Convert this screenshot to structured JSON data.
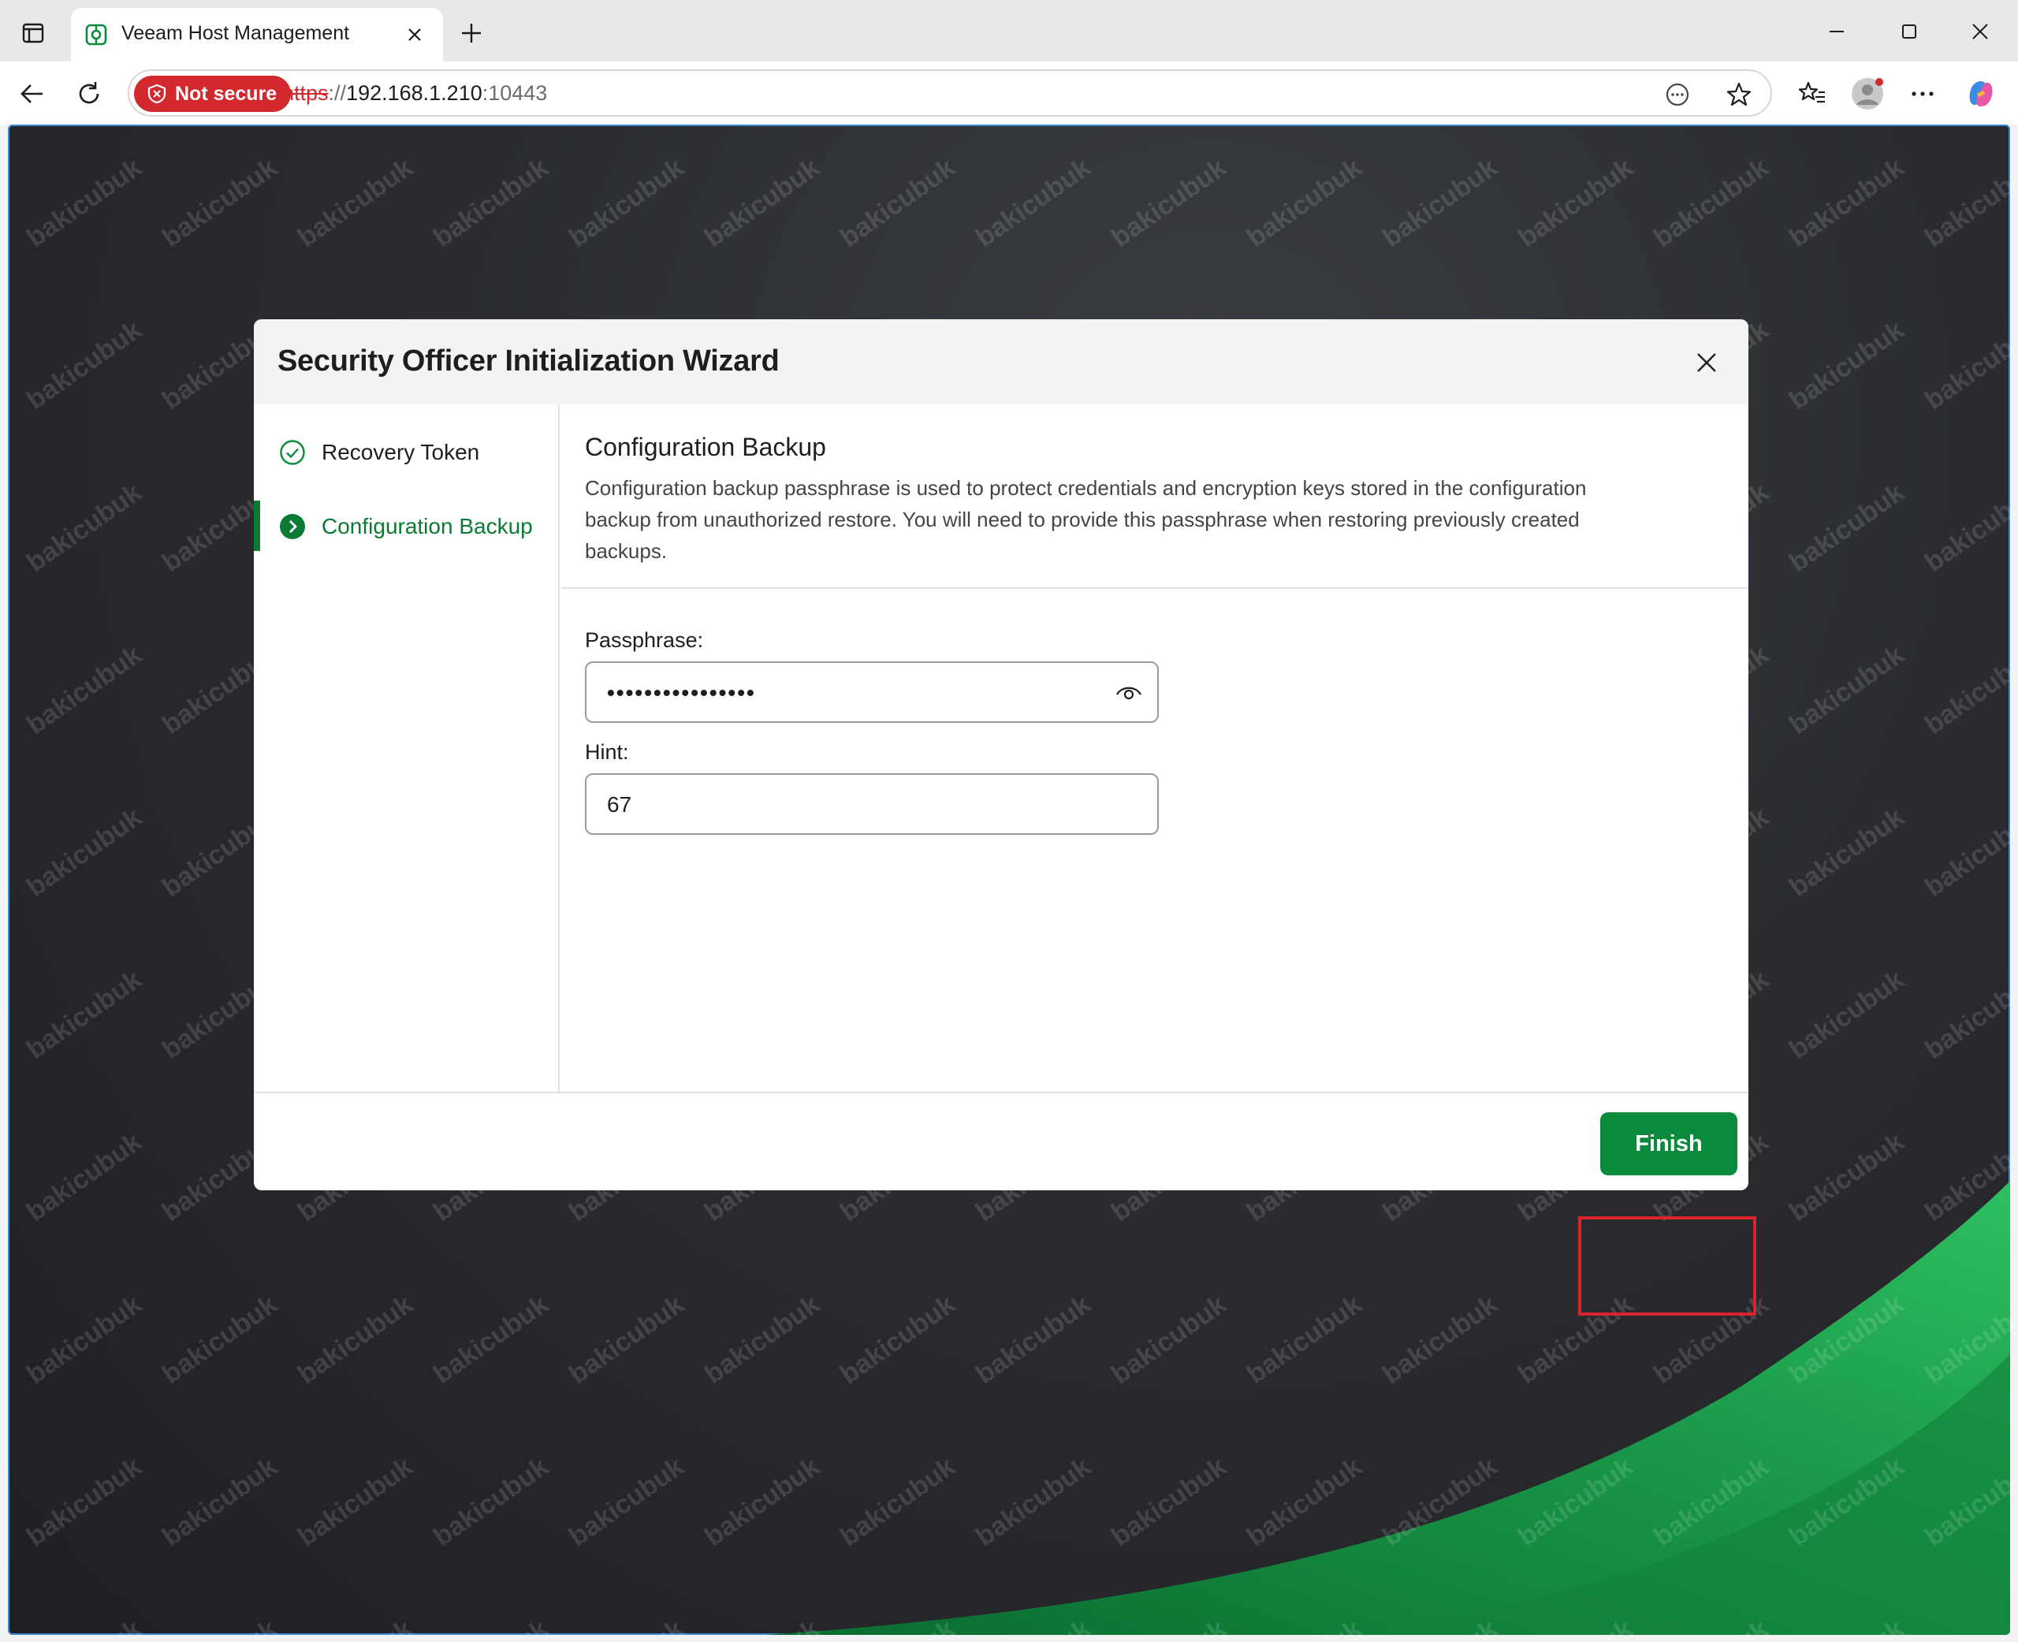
{
  "browser": {
    "tab_title": "Veeam Host Management",
    "security_label": "Not secure",
    "url_scheme": "https",
    "url_separator": "://",
    "url_host": "192.168.1.210",
    "url_port": ":10443"
  },
  "dialog": {
    "title": "Security Officer Initialization Wizard",
    "steps": [
      {
        "label": "Recovery Token",
        "state": "completed"
      },
      {
        "label": "Configuration Backup",
        "state": "active"
      }
    ],
    "section_title": "Configuration Backup",
    "section_description": "Configuration backup passphrase is used to protect credentials and encryption keys stored in the configuration backup from unauthorized restore. You will need to provide this passphrase when restoring previously created backups.",
    "passphrase_label": "Passphrase:",
    "passphrase_value": "••••••••••••••••",
    "hint_label": "Hint:",
    "hint_value": "67",
    "finish_label": "Finish"
  },
  "watermark_text": "bakicubuk",
  "colors": {
    "accent_green": "#0a8a3c",
    "not_secure_red": "#d4282f",
    "highlight_red": "#d8242c"
  }
}
